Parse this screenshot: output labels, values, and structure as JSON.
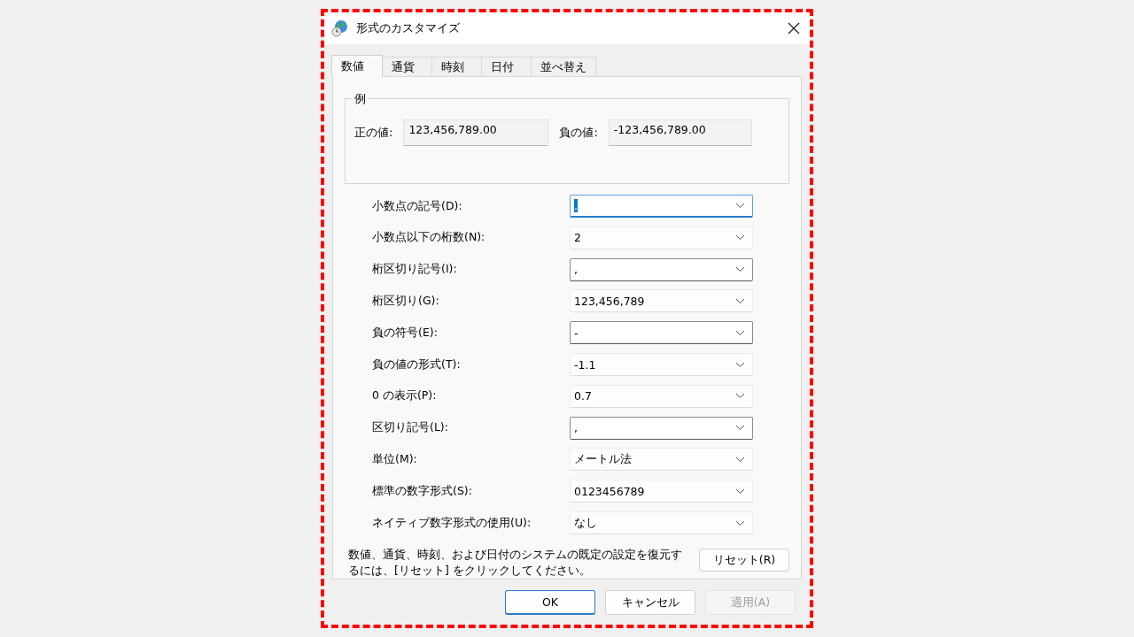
{
  "window": {
    "title": "形式のカスタマイズ"
  },
  "tabs": [
    {
      "label": "数値",
      "selected": true
    },
    {
      "label": "通貨",
      "selected": false
    },
    {
      "label": "時刻",
      "selected": false
    },
    {
      "label": "日付",
      "selected": false
    },
    {
      "label": "並べ替え",
      "selected": false
    }
  ],
  "example": {
    "title": "例",
    "fields": [
      {
        "label": "正の値:",
        "value": "123,456,789.00"
      },
      {
        "label": "負の値:",
        "value": "-123,456,789.00"
      }
    ]
  },
  "settings": [
    {
      "label": "小数点の記号(D):",
      "value": ".",
      "kind": "editable",
      "focused": true
    },
    {
      "label": "小数点以下の桁数(N):",
      "value": "2",
      "kind": "list",
      "focused": false
    },
    {
      "label": "桁区切り記号(I):",
      "value": ",",
      "kind": "editable",
      "focused": false
    },
    {
      "label": "桁区切り(G):",
      "value": "123,456,789",
      "kind": "list",
      "focused": false
    },
    {
      "label": "負の符号(E):",
      "value": "-",
      "kind": "editable",
      "focused": false
    },
    {
      "label": "負の値の形式(T):",
      "value": "-1.1",
      "kind": "list",
      "focused": false
    },
    {
      "label": "0 の表示(P):",
      "value": "0.7",
      "kind": "list",
      "focused": false
    },
    {
      "label": "区切り記号(L):",
      "value": ",",
      "kind": "editable",
      "focused": false
    },
    {
      "label": "単位(M):",
      "value": "メートル法",
      "kind": "list",
      "focused": false
    },
    {
      "label": "標準の数字形式(S):",
      "value": "0123456789",
      "kind": "list",
      "focused": false
    },
    {
      "label": "ネイティブ数字形式の使用(U):",
      "value": "なし",
      "kind": "list",
      "focused": false
    }
  ],
  "reset": {
    "text": "数値、通貨、時刻、および日付のシステムの既定の設定を復元するには、[リセット] をクリックしてください。",
    "button": "リセット(R)"
  },
  "buttons": [
    {
      "label": "OK",
      "kind": "default",
      "disabled": false
    },
    {
      "label": "キャンセル",
      "kind": "normal",
      "disabled": false
    },
    {
      "label": "適用(A)",
      "kind": "normal",
      "disabled": true
    }
  ]
}
